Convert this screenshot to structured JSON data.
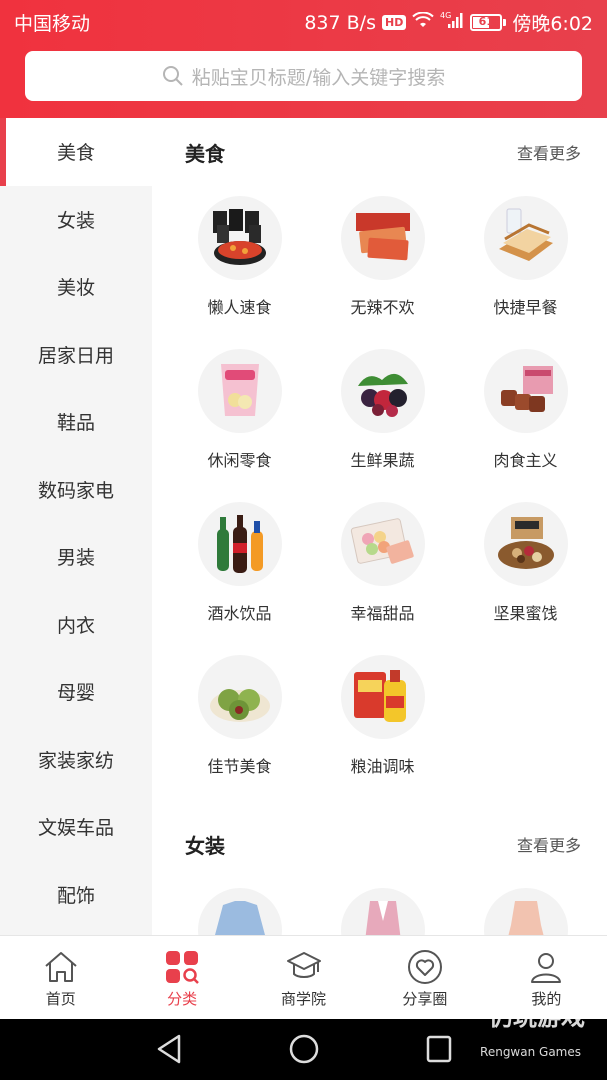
{
  "status_bar": {
    "carrier": "中国移动",
    "speed": "837 B/s",
    "hd": "HD",
    "network": "4G",
    "battery": "61",
    "battery_level": 0.61,
    "time": "傍晚6:02"
  },
  "search": {
    "placeholder": "粘贴宝贝标题/输入关键字搜索"
  },
  "sidebar": {
    "items": [
      {
        "label": "美食"
      },
      {
        "label": "女装"
      },
      {
        "label": "美妆"
      },
      {
        "label": "居家日用"
      },
      {
        "label": "鞋品"
      },
      {
        "label": "数码家电"
      },
      {
        "label": "男装"
      },
      {
        "label": "内衣"
      },
      {
        "label": "母婴"
      },
      {
        "label": "家装家纺"
      },
      {
        "label": "文娱车品"
      },
      {
        "label": "配饰"
      }
    ]
  },
  "sections": [
    {
      "title": "美食",
      "more": "查看更多",
      "items": [
        {
          "label": "懒人速食",
          "icon": "instant-noodles-icon"
        },
        {
          "label": "无辣不欢",
          "icon": "spicy-snack-icon"
        },
        {
          "label": "快捷早餐",
          "icon": "bread-icon"
        },
        {
          "label": "休闲零食",
          "icon": "chips-bag-icon"
        },
        {
          "label": "生鲜果蔬",
          "icon": "berries-icon"
        },
        {
          "label": "肉食主义",
          "icon": "meat-box-icon"
        },
        {
          "label": "酒水饮品",
          "icon": "bottles-icon"
        },
        {
          "label": "幸福甜品",
          "icon": "macaron-icon"
        },
        {
          "label": "坚果蜜饯",
          "icon": "nuts-icon"
        },
        {
          "label": "佳节美食",
          "icon": "rice-cake-icon"
        },
        {
          "label": "粮油调味",
          "icon": "oil-rice-icon"
        }
      ]
    },
    {
      "title": "女装",
      "more": "查看更多",
      "items": [
        {
          "label": "",
          "icon": "blue-shirt-icon"
        },
        {
          "label": "",
          "icon": "pink-coat-icon"
        },
        {
          "label": "",
          "icon": "peach-dress-icon"
        }
      ]
    }
  ],
  "tabbar": {
    "items": [
      {
        "label": "首页",
        "icon": "home-icon"
      },
      {
        "label": "分类",
        "icon": "category-icon"
      },
      {
        "label": "商学院",
        "icon": "graduation-cap-icon"
      },
      {
        "label": "分享圈",
        "icon": "heart-circle-icon"
      },
      {
        "label": "我的",
        "icon": "user-icon"
      }
    ]
  },
  "watermark": {
    "title": "仍玩游戏",
    "subtitle": "Rengwan Games"
  },
  "colors": {
    "accent": "#e8404c",
    "sidebar_bg": "#f5f5f5"
  }
}
